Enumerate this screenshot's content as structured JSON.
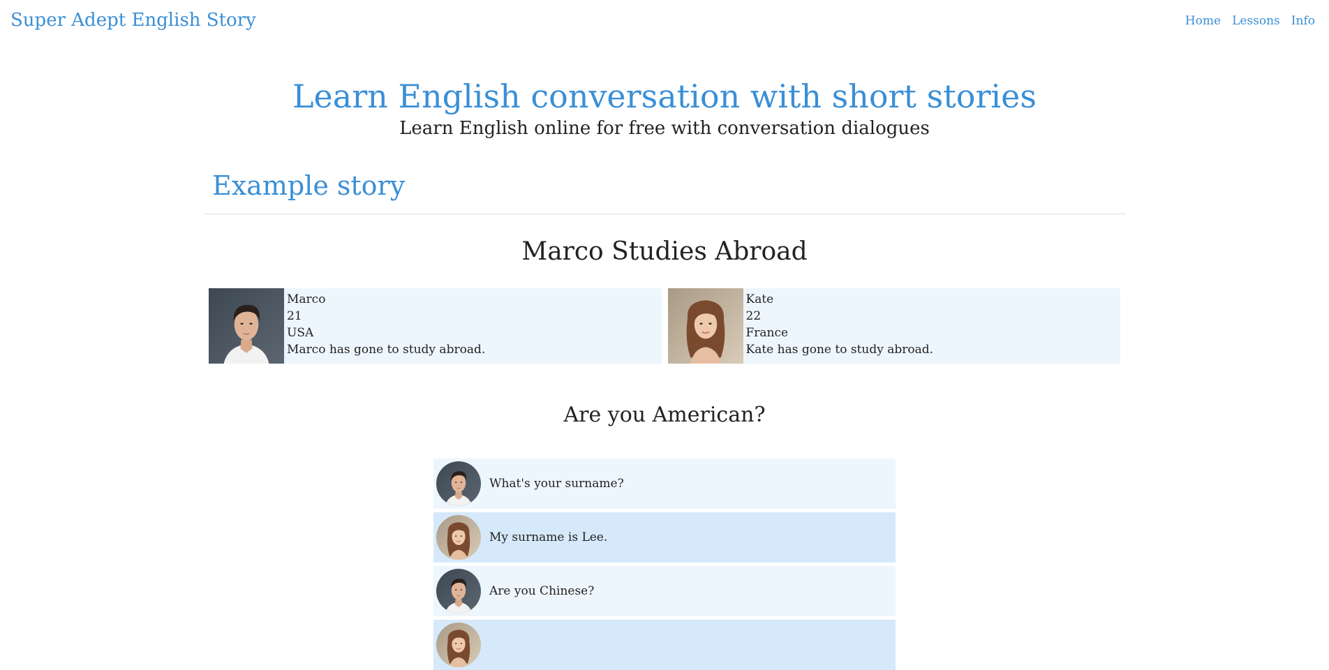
{
  "header": {
    "brand": "Super Adept English Story",
    "nav": [
      "Home",
      "Lessons",
      "Info"
    ]
  },
  "hero": {
    "title": "Learn English conversation with short stories",
    "subtitle": "Learn English online for free with conversation dialogues"
  },
  "section": {
    "title": "Example story",
    "story_title": "Marco Studies Abroad",
    "characters": [
      {
        "name": "Marco",
        "age": "21",
        "country": "USA",
        "bio": "Marco has gone to study abroad.",
        "portrait": "male-portrait"
      },
      {
        "name": "Kate",
        "age": "22",
        "country": "France",
        "bio": "Kate has gone to study abroad.",
        "portrait": "female-portrait"
      }
    ],
    "scene_title": "Are you American?",
    "dialogue": [
      {
        "speaker": "Marco",
        "text": "What's your surname?"
      },
      {
        "speaker": "Kate",
        "text": "My surname is Lee."
      },
      {
        "speaker": "Marco",
        "text": "Are you Chinese?"
      },
      {
        "speaker": "Kate",
        "text": ""
      }
    ]
  },
  "colors": {
    "accent": "#3a8fd6",
    "card_bg": "#eef6fd",
    "card_alt_bg": "#d5e9fa"
  }
}
